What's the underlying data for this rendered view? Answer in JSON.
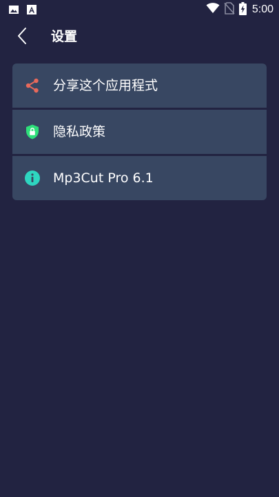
{
  "status_bar": {
    "time": "5:00",
    "icons": [
      "image-icon",
      "font-icon",
      "wifi-icon",
      "no-sim-icon",
      "battery-charging-icon"
    ]
  },
  "app_bar": {
    "title": "设置",
    "back_icon": "chevron-left-icon"
  },
  "settings": {
    "items": [
      {
        "label": "分享这个应用程式",
        "icon": "share-icon",
        "icon_color": "#E8695B"
      },
      {
        "label": "隐私政策",
        "icon": "shield-lock-icon",
        "icon_color": "#2EE07A"
      },
      {
        "label": "Mp3Cut Pro 6.1",
        "icon": "info-icon",
        "icon_color": "#2ED6C0"
      }
    ]
  },
  "colors": {
    "background": "#222341",
    "row_background": "#384762",
    "text": "#FFFFFF"
  }
}
